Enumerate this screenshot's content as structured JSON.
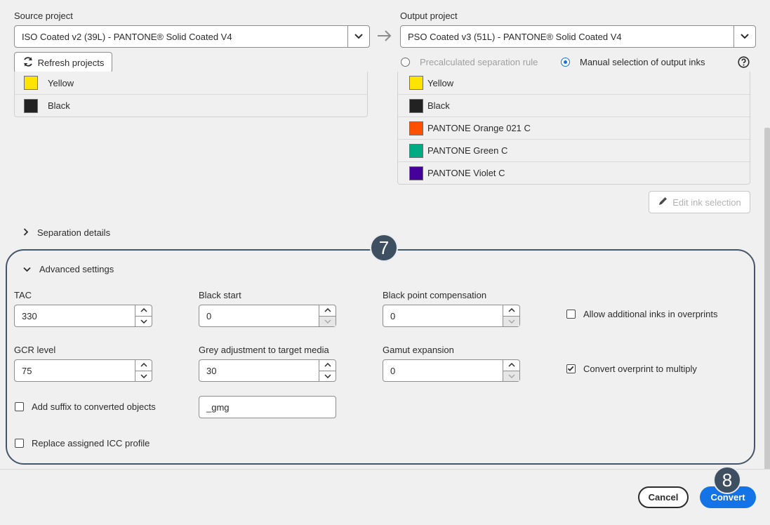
{
  "source": {
    "label": "Source project",
    "value": "ISO Coated v2 (39L) - PANTONE® Solid Coated V4",
    "refresh_label": "Refresh projects",
    "inks": [
      {
        "name": "Yellow",
        "color": "#ffe400"
      },
      {
        "name": "Black",
        "color": "#222222"
      }
    ]
  },
  "output": {
    "label": "Output project",
    "value": "PSO Coated v3 (51L) - PANTONE® Solid Coated V4",
    "radio_precalc": "Precalculated separation rule",
    "radio_manual": "Manual selection of output inks",
    "inks": [
      {
        "name": "Yellow",
        "color": "#ffe400"
      },
      {
        "name": "Black",
        "color": "#222222"
      },
      {
        "name": "PANTONE Orange 021 C",
        "color": "#fe5000"
      },
      {
        "name": "PANTONE Green C",
        "color": "#00ab84"
      },
      {
        "name": "PANTONE Violet C",
        "color": "#440099"
      }
    ],
    "edit_label": "Edit ink selection"
  },
  "separation_details": "Separation details",
  "advanced": {
    "title": "Advanced settings",
    "tac_label": "TAC",
    "tac_value": "330",
    "black_start_label": "Black start",
    "black_start_value": "0",
    "bpc_label": "Black point compensation",
    "bpc_value": "0",
    "allow_inks_label": "Allow additional inks in overprints",
    "gcr_label": "GCR level",
    "gcr_value": "75",
    "grey_label": "Grey adjustment to target media",
    "grey_value": "30",
    "gamut_label": "Gamut expansion",
    "gamut_value": "0",
    "convert_overprint_label": "Convert overprint to multiply",
    "suffix_label": "Add suffix to converted objects",
    "suffix_value": "_gmg",
    "replace_icc_label": "Replace assigned ICC profile"
  },
  "footer": {
    "cancel": "Cancel",
    "convert": "Convert"
  },
  "callouts": {
    "c7": "7",
    "c8": "8"
  },
  "colors": {
    "accent": "#1473e6",
    "callout": "#3e4f62"
  }
}
